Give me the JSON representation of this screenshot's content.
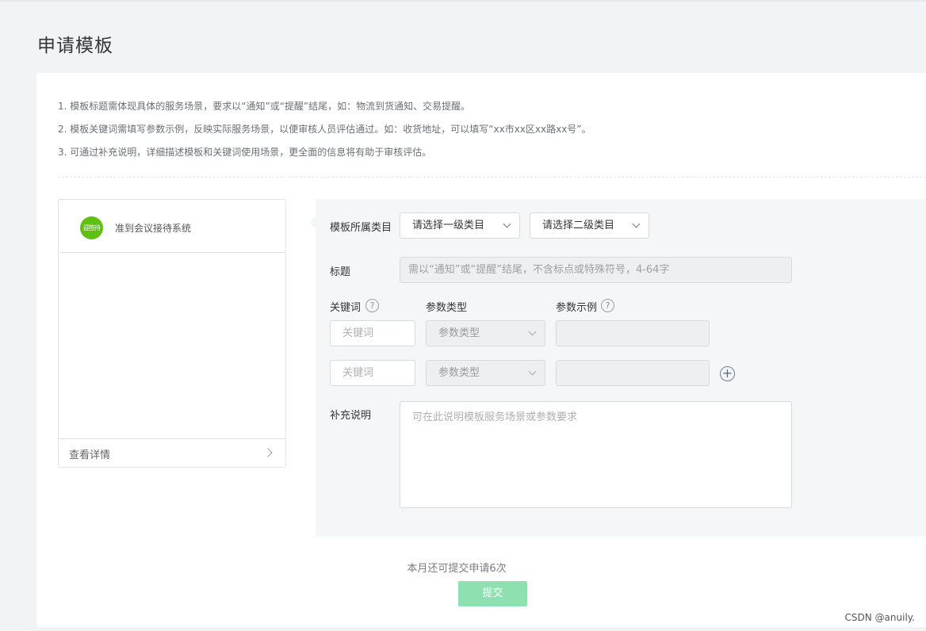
{
  "page": {
    "title": "申请模板"
  },
  "tips": [
    "1. 模板标题需体现具体的服务场景，要求以“通知”或“提醒”结尾，如：物流到货通知、交易提醒。",
    "2. 模板关键词需填写参数示例，反映实际服务场景，以便审核人员评估通过。如：收货地址，可以填写“xx市xx区xx路xx号”。",
    "3. 可通过补充说明，详细描述模板和关键词使用场景，更全面的信息将有助于审核评估。"
  ],
  "preview": {
    "avatar_text": "迎签待",
    "account_name": "准到会议接待系统",
    "view_detail": "查看详情",
    "avatar_color": "#5fbf12"
  },
  "form": {
    "category_label": "模板所属类目",
    "category_primary": "请选择一级类目",
    "category_secondary": "请选择二级类目",
    "title_label": "标题",
    "title_placeholder": "需以“通知”或“提醒”结尾，不含标点或特殊符号，4-64字",
    "keyword_header": "关键词",
    "param_type_header": "参数类型",
    "param_example_header": "参数示例",
    "rows": [
      {
        "keyword_placeholder": "关键词",
        "param_type": "参数类型",
        "example": ""
      },
      {
        "keyword_placeholder": "关键词",
        "param_type": "参数类型",
        "example": ""
      }
    ],
    "note_label": "补充说明",
    "note_placeholder": "可在此说明模板服务场景或参数要求"
  },
  "footer": {
    "quota_text": "本月还可提交申请6次",
    "submit_label": "提交",
    "submit_color": "#8fe0b0"
  },
  "watermark": "CSDN @anuily."
}
